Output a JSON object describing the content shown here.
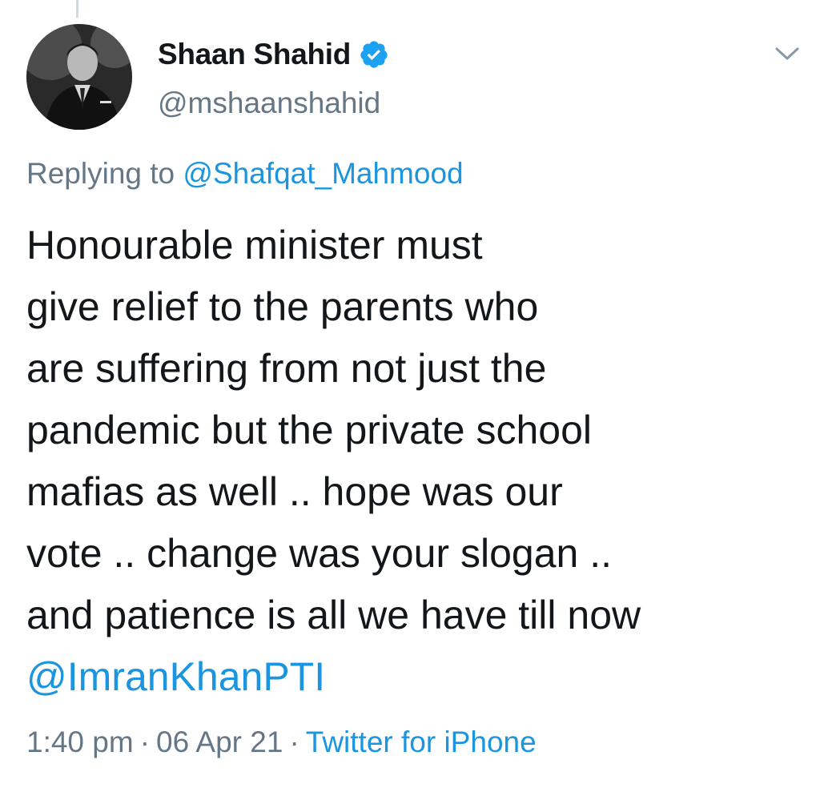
{
  "author": {
    "display_name": "Shaan Shahid",
    "handle": "@mshaanshahid",
    "verified": true
  },
  "reply": {
    "prefix": "Replying to",
    "mention": "@Shafqat_Mahmood"
  },
  "tweet": {
    "lines": [
      "Honourable minister must",
      "give relief to the parents who",
      "are suffering from not just the",
      "pandemic but the private school",
      "mafias as well .. hope was our",
      "vote .. change was your slogan ..",
      "and patience is all we have till now"
    ],
    "mention": "@ImranKhanPTI"
  },
  "meta": {
    "time": "1:40 pm",
    "separator": "·",
    "date": "06 Apr 21",
    "source": "Twitter for iPhone"
  },
  "icons": {
    "verified": "verified-badge-icon",
    "menu": "chevron-down-icon"
  },
  "colors": {
    "accent": "#1b95e0",
    "text": "#14171a",
    "muted": "#657786",
    "verified": "#1da1f2"
  }
}
